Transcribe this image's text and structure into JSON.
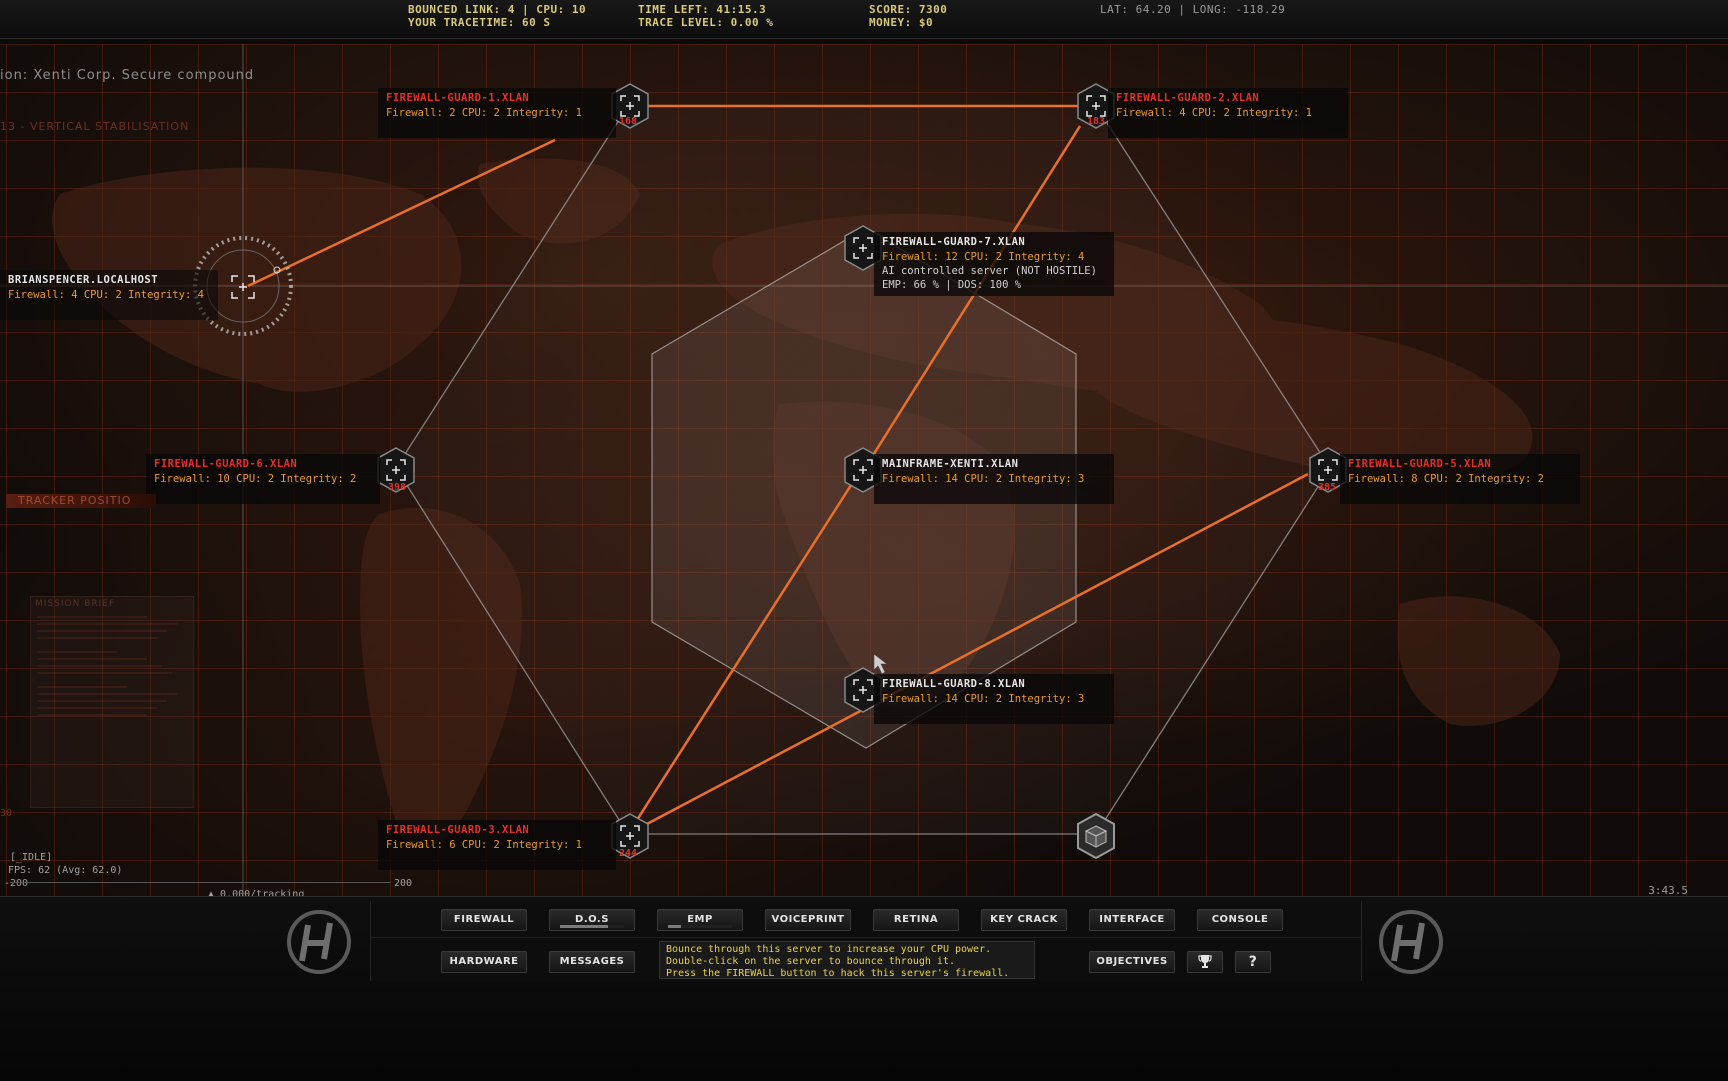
{
  "hud": {
    "bounced_link": "Bounced link: 4 | CPU: 10",
    "tracetime": "Your tracetime: 60 s",
    "time_left": "Time left: 41:15.3",
    "trace_level": "Trace level: 0.00 %",
    "score": "Score: 7300",
    "money": "Money: $0",
    "coords": "LAT: 64.20 | LONG: -118.29"
  },
  "mission": {
    "title": "ion: Xenti Corp. Secure compound",
    "subtitle": "13 - Vertical stabilisation",
    "tracker_tab": "Tracker positio",
    "brief_title": "Mission brief",
    "left_edge_value": "30"
  },
  "nodes": [
    {
      "id": "fg1",
      "name": "firewall-guard-1.xlan",
      "stats": "Firewall: 2 CPU: 2 Integrity: 1",
      "num": "168",
      "type": "hostile"
    },
    {
      "id": "fg2",
      "name": "firewall-guard-2.xlan",
      "stats": "Firewall: 4 CPU: 2 Integrity: 1",
      "num": "183",
      "type": "hostile"
    },
    {
      "id": "home",
      "name": "brianspencer.localhost",
      "stats": "Firewall: 4 CPU: 2 Integrity: 4",
      "type": "home"
    },
    {
      "id": "fg7",
      "name": "firewall-guard-7.xlan",
      "stats": "Firewall: 12 CPU: 2 Integrity: 4",
      "extra1": "AI controlled server (NOT HOSTILE)",
      "extra2": "EMP:  66 % | DOS: 100 %",
      "type": "neutral"
    },
    {
      "id": "fg6",
      "name": "firewall-guard-6.xlan",
      "stats": "Firewall: 10 CPU: 2 Integrity: 2",
      "num": "398",
      "type": "hostile"
    },
    {
      "id": "main",
      "name": "mainframe-xenti.xlan",
      "stats": "Firewall: 14 CPU: 2 Integrity: 3",
      "type": "neutral"
    },
    {
      "id": "fg5",
      "name": "firewall-guard-5.xlan",
      "stats": "Firewall: 8 CPU: 2 Integrity: 2",
      "num": "385",
      "type": "hostile"
    },
    {
      "id": "fg8",
      "name": "firewall-guard-8.xlan",
      "stats": "Firewall: 14 CPU: 2 Integrity: 3",
      "type": "neutral"
    },
    {
      "id": "fg3",
      "name": "firewall-guard-3.xlan",
      "stats": "Firewall: 6 CPU: 2 Integrity: 1",
      "num": "244",
      "type": "hostile"
    }
  ],
  "debug": {
    "idle": "[_IDLE]",
    "fps": "FPS:  62 (Avg: 62.0)",
    "range_min": "-200",
    "range_max": "200",
    "tracking": "0.000/tracking",
    "clock": "3:43.5"
  },
  "toolbar": {
    "row1": [
      {
        "label": "Firewall"
      },
      {
        "label": "D.O.S",
        "progress": 0.75
      },
      {
        "label": "EMP",
        "progress": 0.2
      },
      {
        "label": "Voiceprint"
      },
      {
        "label": "Retina"
      },
      {
        "label": "Key crack"
      },
      {
        "label": "Interface"
      },
      {
        "label": "Console"
      }
    ],
    "row2": [
      {
        "label": "Hardware"
      },
      {
        "label": "Messages"
      },
      {
        "label": "Objectives"
      }
    ],
    "info": [
      "Bounce through this server to increase your CPU power.",
      "Double-click on the server to bounce through it.",
      "Press the FIREWALL button to hack this server's firewall."
    ],
    "trophy_icon": "trophy-icon",
    "help_label": "?"
  },
  "colors": {
    "accent_orange": "#e8702a",
    "hostile_red": "#e5302a",
    "stats_orange": "#e89a2e",
    "hud_yellow": "#d9c97a",
    "info_yellow": "#e9d24a"
  }
}
